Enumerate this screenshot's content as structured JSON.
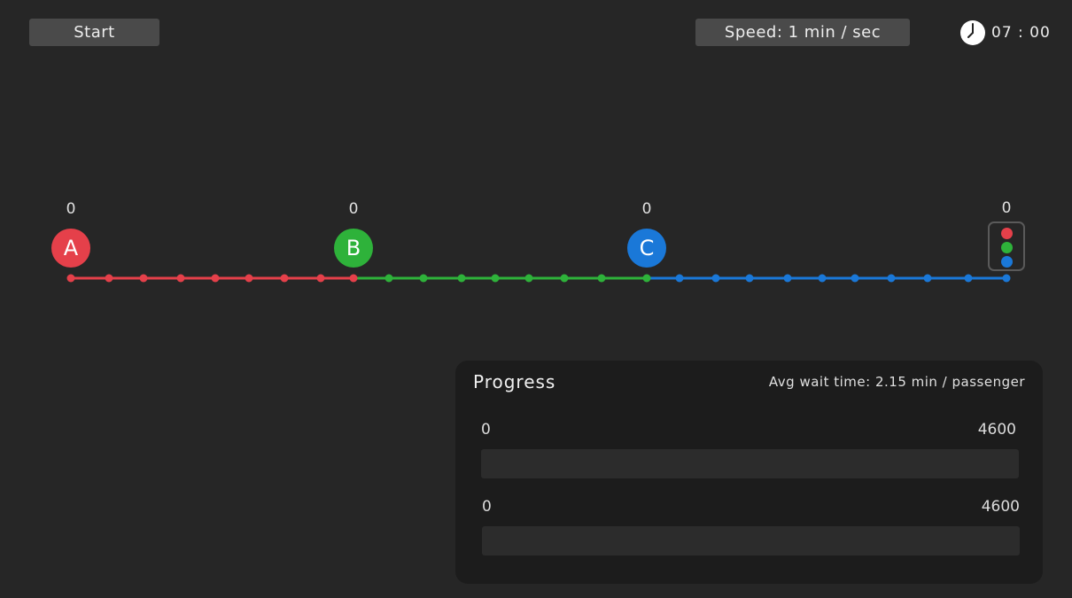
{
  "toolbar": {
    "start_label": "Start",
    "speed_label": "Speed: 1 min / sec",
    "clock_icon": "clock-icon",
    "clock_time": "07 : 00"
  },
  "colors": {
    "red": "#e5404a",
    "green": "#2eb23a",
    "blue": "#1a78d8",
    "panel": "#1c1c1c"
  },
  "line": {
    "stations": [
      {
        "label": "A",
        "count": "0",
        "color": "#e5404a"
      },
      {
        "label": "B",
        "count": "0",
        "color": "#2eb23a"
      },
      {
        "label": "C",
        "count": "0",
        "color": "#1a78d8"
      }
    ],
    "terminal": {
      "count": "0",
      "icon": "traffic-light-icon"
    }
  },
  "progress": {
    "title": "Progress",
    "avg_wait": "Avg wait time: 2.15 min / passenger",
    "bars": [
      {
        "min": "0",
        "max": "4600",
        "value": 0
      },
      {
        "min": "0",
        "max": "4600",
        "value": 0
      }
    ]
  }
}
